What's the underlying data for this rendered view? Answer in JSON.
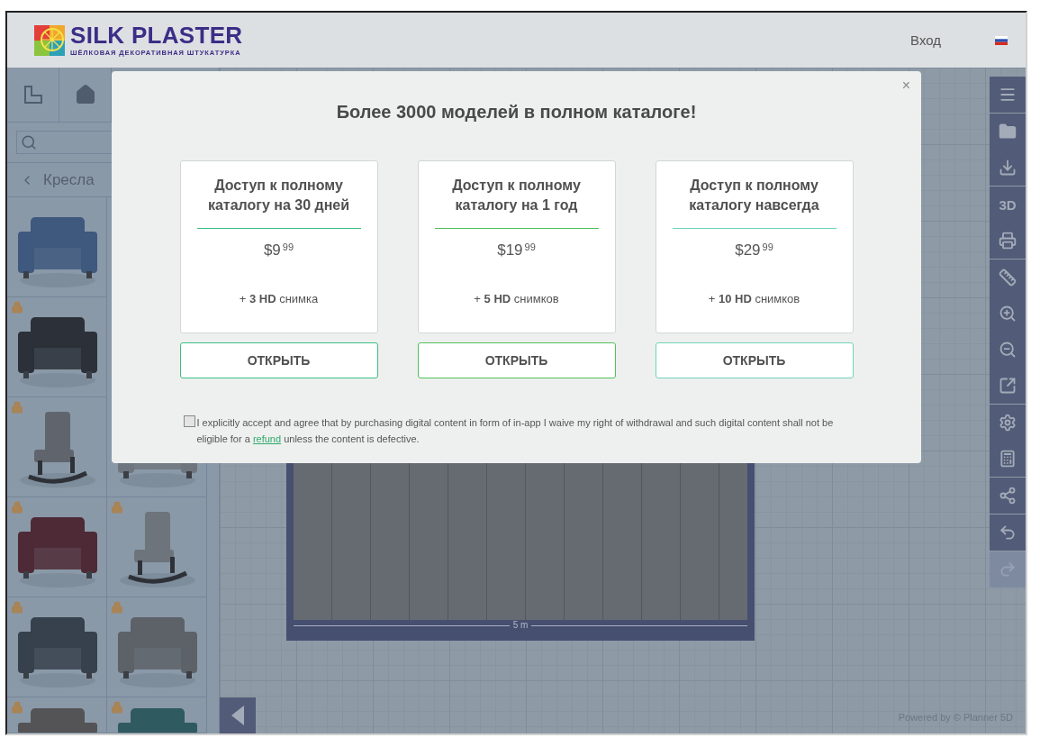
{
  "header": {
    "brand": "SILK PLASTER",
    "tagline": "ШЁЛКОВАЯ ДЕКОРАТИВНАЯ ШТУКАТУРКА",
    "login": "Вход"
  },
  "sidebar": {
    "category": "Кресла",
    "rows": [
      {
        "items": [
          {
            "kind": "picture",
            "locked": false
          }
        ]
      },
      {
        "items": [
          {
            "kind": "picture",
            "locked": true
          }
        ]
      },
      {
        "items": [
          {
            "kind": "picture",
            "locked": true
          },
          {
            "kind": "picture"
          }
        ]
      },
      {
        "items": [
          {
            "kind": "picture",
            "locked": true
          },
          {
            "kind": "picture",
            "locked": true
          }
        ]
      },
      {
        "items": [
          {
            "kind": "picture",
            "locked": true
          },
          {
            "kind": "picture",
            "locked": true
          }
        ]
      },
      {
        "items": [
          {
            "kind": "picture",
            "locked": true
          },
          {
            "kind": "picture",
            "locked": true
          }
        ]
      }
    ]
  },
  "canvas": {
    "dimension": "5 m",
    "powered_by": "Powered by © Planner 5D"
  },
  "toolbar": {
    "label_3d": "3D",
    "redo_disabled": true
  },
  "modal": {
    "close": "×",
    "title": "Более 3000 моделей в полном каталоге!",
    "plans": [
      {
        "title": "Доступ к полному каталогу на 30 дней",
        "price": "$9",
        "cents": "99",
        "extra": "+ **3 HD** снимка",
        "button": "ОТКРЫТЬ",
        "color": "#3cbf85"
      },
      {
        "title": "Доступ к полному каталогу на 1 год",
        "price": "$19",
        "cents": "99",
        "extra": "+ **5 HD** снимков",
        "button": "ОТКРЫТЬ",
        "color": "#52c15a"
      },
      {
        "title": "Доступ к полному каталогу навсегда",
        "price": "$29",
        "cents": "99",
        "extra": "+ **10 HD** снимков",
        "button": "ОТКРЫТЬ",
        "color": "#6fd3b9"
      }
    ],
    "consent": {
      "checked": false,
      "before": "I explicitly accept and agree that by purchasing digital content in form of in-app I waive my right of withdrawal and such digital content shall not be eligible for a",
      "link": "refund",
      "after": "unless the content is defective."
    }
  }
}
